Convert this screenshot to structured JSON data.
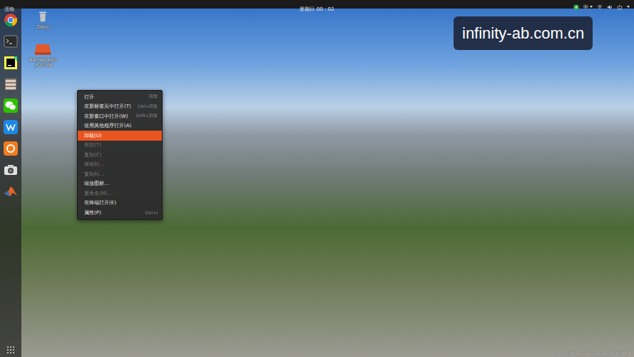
{
  "top_bar": {
    "activities": "活动",
    "clock": "星期日 00：02",
    "input_method": "中"
  },
  "desktop_icons": [
    {
      "label": "回收站",
      "kind": "trash"
    },
    {
      "label": "MATHWORKS_R2018B",
      "kind": "drive"
    }
  ],
  "context_menu": {
    "items": [
      {
        "label": "打开",
        "shortcut": "回车",
        "disabled": false,
        "selected": false
      },
      {
        "label": "在新标签页中打开(T)",
        "shortcut": "Ctrl+回车",
        "disabled": false,
        "selected": false
      },
      {
        "label": "在新窗口中打开(W)",
        "shortcut": "Shift+回车",
        "disabled": false,
        "selected": false
      },
      {
        "label": "使用其他程序打开(A)",
        "shortcut": "",
        "disabled": false,
        "selected": false
      },
      {
        "label": "卸载(U)",
        "shortcut": "",
        "disabled": false,
        "selected": true
      },
      {
        "label": "剪切(T)",
        "shortcut": "",
        "disabled": true,
        "selected": false
      },
      {
        "label": "复制(C)",
        "shortcut": "",
        "disabled": true,
        "selected": false
      },
      {
        "label": "移动到…",
        "shortcut": "",
        "disabled": true,
        "selected": false
      },
      {
        "label": "复制到…",
        "shortcut": "",
        "disabled": true,
        "selected": false
      },
      {
        "label": "缩放图标…",
        "shortcut": "",
        "disabled": false,
        "selected": false
      },
      {
        "label": "重命名(M)…",
        "shortcut": "",
        "disabled": true,
        "selected": false
      },
      {
        "label": "在终端打开(E)",
        "shortcut": "",
        "disabled": false,
        "selected": false
      },
      {
        "label": "属性(P)",
        "shortcut": "Ctrl+I",
        "disabled": false,
        "selected": false
      }
    ]
  },
  "watermark": "infinity-ab.com.cn",
  "credit": "https://blog.csdn.net/qq_41103804"
}
